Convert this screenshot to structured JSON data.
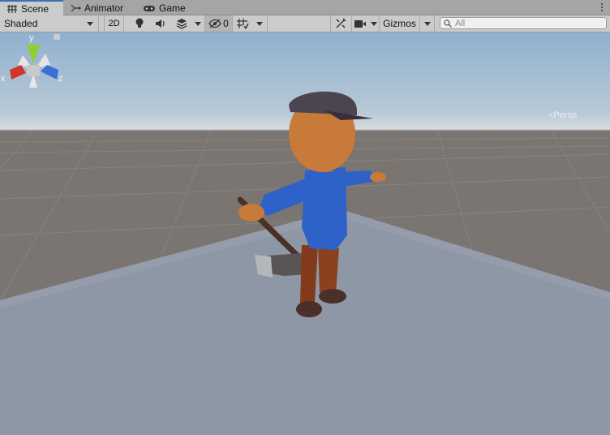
{
  "tabs": [
    {
      "label": "Scene",
      "icon": "grid-icon",
      "active": true
    },
    {
      "label": "Animator",
      "icon": "animator-icon",
      "active": false
    },
    {
      "label": "Game",
      "icon": "gamepad-icon",
      "active": false
    }
  ],
  "toolbar": {
    "draw_mode": "Shaded",
    "toggle_2d": "2D",
    "hidden_count": "0",
    "gizmos_label": "Gizmos",
    "search_placeholder": "All"
  },
  "orientation_gizmo": {
    "axis_x": "x",
    "axis_y": "y",
    "axis_z": "z",
    "projection_label": "<Persp",
    "colors": {
      "x": "#d0352b",
      "y": "#8ed12f",
      "z": "#3a6fd8"
    }
  },
  "colors": {
    "accent": "#3a72b0",
    "sky": "#8fb0d0",
    "ground": "#7b7571",
    "plane": "#8e97a6"
  }
}
